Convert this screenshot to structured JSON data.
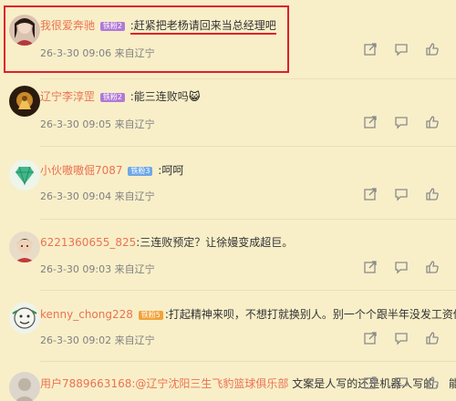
{
  "comments": [
    {
      "user": "我很爱奔驰",
      "badge": "铁粉2",
      "text": ":赶紧把老杨请回来当总经理吧",
      "meta": "26-3-30 09:06 来自辽宁"
    },
    {
      "user": "辽宁李淳罡",
      "badge": "铁粉2",
      "text": ":能三连败吗",
      "emoji": "😺",
      "meta": "26-3-30 09:05 来自辽宁"
    },
    {
      "user": "小伙嗷嗷倔7087",
      "badge": "铁粉3",
      "text": ":呵呵",
      "meta": "26-3-30 09:04 来自辽宁"
    },
    {
      "user": "6221360655_825",
      "text": ":三连败预定？让徐嫚变成超巨。",
      "meta": "26-3-30 09:03 来自辽宁"
    },
    {
      "user": "kenny_chong228",
      "badge": "铁粉5",
      "text": ":打起精神来呗，不想打就换别人。别一个个跟半年没发工资似的。",
      "meta": "26-3-30 09:02 来自辽宁"
    },
    {
      "user": "用户7889663168",
      "mention": ":@辽宁沈阳三生飞豹篮球俱乐部",
      "text": " 文案是人写的还是机器人写的， 能不能别提"
    }
  ],
  "colors": {
    "background": "#f8efc9",
    "username": "#eb7350",
    "highlight": "#e01e2b"
  },
  "icons": [
    "share-icon",
    "comment-icon",
    "like-icon"
  ]
}
